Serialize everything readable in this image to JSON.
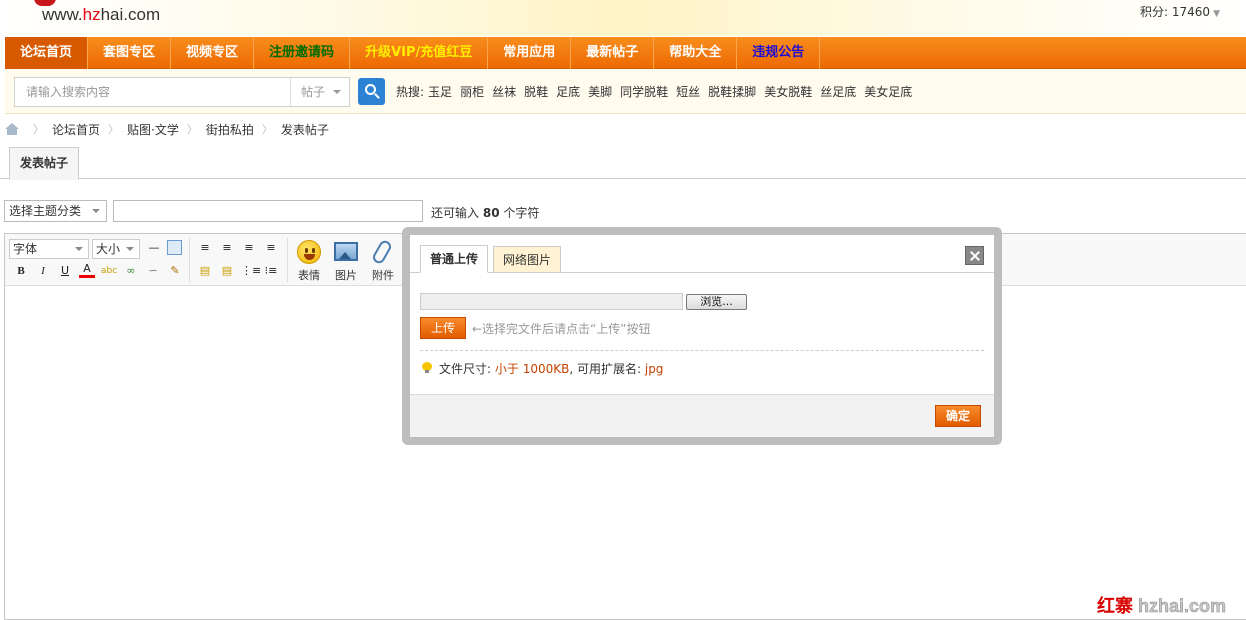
{
  "header": {
    "site_url_prefix": "www.",
    "site_url_highlight": "hz",
    "site_url_suffix": "hai.com",
    "credits_label": "积分: 17460"
  },
  "nav": {
    "items": [
      {
        "label": "论坛首页"
      },
      {
        "label": "套图专区"
      },
      {
        "label": "视频专区"
      },
      {
        "label": "注册邀请码"
      },
      {
        "label": "升级VIP/充值红豆"
      },
      {
        "label": "常用应用"
      },
      {
        "label": "最新帖子"
      },
      {
        "label": "帮助大全"
      },
      {
        "label": "违规公告"
      }
    ]
  },
  "search": {
    "placeholder": "请输入搜索内容",
    "type_selected": "帖子",
    "hot_label": "热搜:",
    "hot_words": [
      "玉足",
      "丽柜",
      "丝袜",
      "脱鞋",
      "足底",
      "美脚",
      "同学脱鞋",
      "短丝",
      "脱鞋揉脚",
      "美女脱鞋",
      "丝足底",
      "美女足底"
    ]
  },
  "breadcrumb": [
    "论坛首页",
    "贴图·文学",
    "街拍私拍",
    "发表帖子"
  ],
  "tabs": {
    "post": "发表帖子"
  },
  "form": {
    "category_placeholder": "选择主题分类",
    "char_tip_prefix": "还可输入",
    "char_tip_count": "80",
    "char_tip_suffix": "个字符"
  },
  "editor": {
    "font_select": "字体",
    "size_select": "大小",
    "smiley_label": "表情",
    "image_label": "图片",
    "attach_label": "附件"
  },
  "modal": {
    "tab_normal": "普通上传",
    "tab_web": "网络图片",
    "browse_label": "浏览...",
    "upload_label": "上传",
    "upload_tip": "←选择完文件后请点击“上传”按钮",
    "size_prefix": "文件尺寸:",
    "size_value": "小于 1000KB",
    "ext_prefix": ", 可用扩展名:",
    "ext_value": "jpg",
    "ok_label": "确定"
  },
  "watermark": {
    "cn": "红寨",
    "en": " hzhai.com"
  },
  "colors": {
    "nav_bg": "#ef7a0e",
    "accent_orange": "#e35b00",
    "search_button": "#2e82d4",
    "register_green": "#006d00",
    "vip_yellow": "#ffee00",
    "notice_blue": "#1c0bd6"
  }
}
